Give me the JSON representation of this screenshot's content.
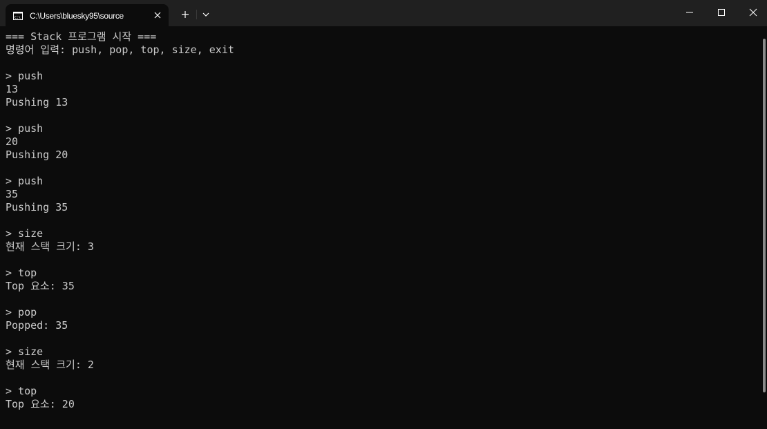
{
  "window": {
    "tab_title": "C:\\Users\\bluesky95\\source"
  },
  "terminal": {
    "lines": [
      "=== Stack 프로그램 시작 ===",
      "명령어 입력: push, pop, top, size, exit",
      "",
      "> push",
      "13",
      "Pushing 13",
      "",
      "> push",
      "20",
      "Pushing 20",
      "",
      "> push",
      "35",
      "Pushing 35",
      "",
      "> size",
      "현재 스택 크기: 3",
      "",
      "> top",
      "Top 요소: 35",
      "",
      "> pop",
      "Popped: 35",
      "",
      "> size",
      "현재 스택 크기: 2",
      "",
      "> top",
      "Top 요소: 20"
    ]
  },
  "icons": {
    "tab": "terminal-icon",
    "close_tab": "close-icon",
    "new_tab": "plus-icon",
    "dropdown": "chevron-down-icon",
    "minimize": "minimize-icon",
    "maximize": "maximize-icon",
    "close_window": "close-icon"
  },
  "colors": {
    "background": "#0c0c0c",
    "titlebar": "#202020",
    "text": "#cccccc"
  }
}
